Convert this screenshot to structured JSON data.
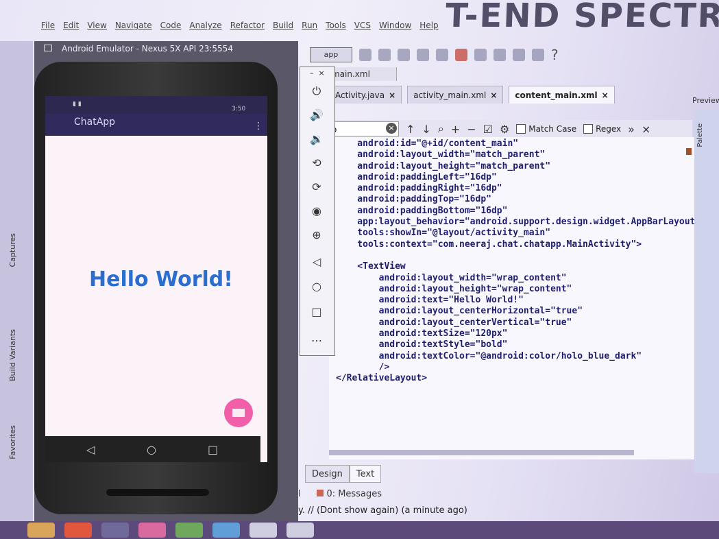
{
  "banner": "T-END SPECTR",
  "menu": [
    "File",
    "Edit",
    "View",
    "Navigate",
    "Code",
    "Analyze",
    "Refactor",
    "Build",
    "Run",
    "Tools",
    "VCS",
    "Window",
    "Help"
  ],
  "toolbar": {
    "run_config": "app"
  },
  "breadcrumb": "_main.xml",
  "tabs": [
    {
      "label": "Activity.java"
    },
    {
      "label": "activity_main.xml"
    },
    {
      "label": "content_main.xml",
      "active": true
    }
  ],
  "preview_label": "Preview",
  "palette_label": "Palette",
  "search": {
    "value": "o",
    "match_case": "Match Case",
    "regex": "Regex"
  },
  "code_lines": [
    "    android:id=\"@+id/content_main\"",
    "    android:layout_width=\"match_parent\"",
    "    android:layout_height=\"match_parent\"",
    "    android:paddingLeft=\"16dp\"",
    "    android:paddingRight=\"16dp\"",
    "    android:paddingTop=\"16dp\"",
    "    android:paddingBottom=\"16dp\"",
    "    app:layout_behavior=\"android.support.design.widget.AppBarLayout$Scro",
    "    tools:showIn=\"@layout/activity_main\"",
    "    tools:context=\"com.neeraj.chat.chatapp.MainActivity\">",
    "",
    "    <TextView",
    "        android:layout_width=\"wrap_content\"",
    "        android:layout_height=\"wrap_content\"",
    "        android:text=\"Hello World!\"",
    "        android:layout_centerHorizontal=\"true\"",
    "        android:layout_centerVertical=\"true\"",
    "        android:textSize=\"120px\"",
    "        android:textStyle=\"bold\"",
    "        android:textColor=\"@android:color/holo_blue_dark\"",
    "        />",
    "</RelativeLayout>"
  ],
  "bottom_tabs": {
    "design": "Design",
    "text": "Text"
  },
  "tool_windows": {
    "terminal": "inal",
    "messages": "0: Messages"
  },
  "status_text": "ivity. // (Dont show again) (a minute ago)",
  "left_strip": {
    "captures": "Captures",
    "build_variants": "Build Variants",
    "favorites": "Favorites"
  },
  "emulator": {
    "title": "Android Emulator - Nexus 5X API 23:5554",
    "status_time": "3:50",
    "app_title": "ChatApp",
    "hello": "Hello World!"
  },
  "colors": {
    "accent": "#2a6fd0",
    "appbar": "#302b5c",
    "fab": "#f05fa8"
  }
}
